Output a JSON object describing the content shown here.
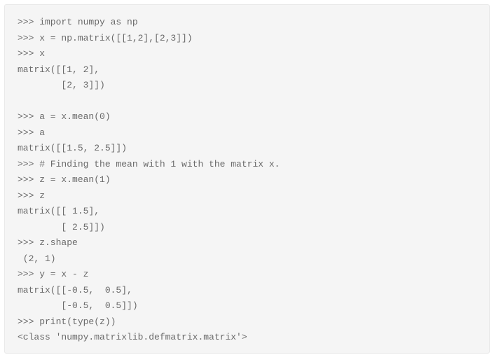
{
  "code": {
    "lines": [
      ">>> import numpy as np",
      ">>> x = np.matrix([[1,2],[2,3]])",
      ">>> x",
      "matrix([[1, 2],",
      "        [2, 3]])",
      "",
      ">>> a = x.mean(0)",
      ">>> a",
      "matrix([[1.5, 2.5]])",
      ">>> # Finding the mean with 1 with the matrix x.",
      ">>> z = x.mean(1)",
      ">>> z",
      "matrix([[ 1.5],",
      "        [ 2.5]])",
      ">>> z.shape",
      " (2, 1)",
      ">>> y = x - z",
      "matrix([[-0.5,  0.5],",
      "        [-0.5,  0.5]])",
      ">>> print(type(z))",
      "<class 'numpy.matrixlib.defmatrix.matrix'>"
    ]
  }
}
